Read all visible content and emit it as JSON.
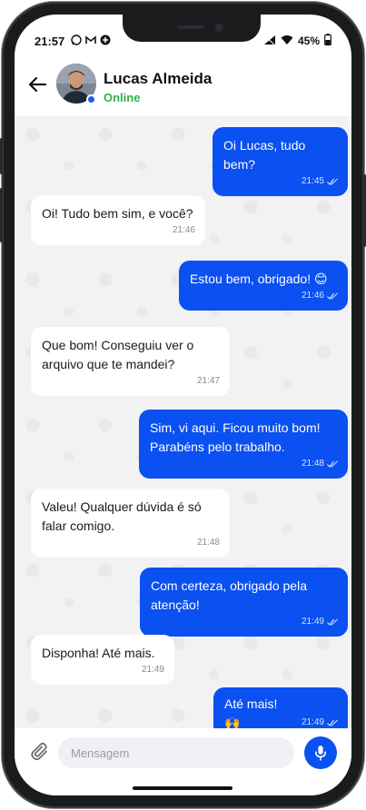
{
  "status_bar": {
    "time": "21:57",
    "battery": "45%"
  },
  "header": {
    "contact_name": "Lucas Almeida",
    "contact_status": "Online"
  },
  "messages": [
    {
      "direction": "out",
      "text": "Oi Lucas, tudo bem?",
      "time": "21:45",
      "read": true
    },
    {
      "direction": "in",
      "text": "Oi! Tudo bem sim, e você?",
      "time": "21:46"
    },
    {
      "direction": "out",
      "text": "Estou bem, obrigado! 😊",
      "time": "21:46",
      "read": true
    },
    {
      "direction": "in",
      "text": "Que bom! Conseguiu ver o\narquivo que te mandei?",
      "time": "21:47"
    },
    {
      "direction": "out",
      "text": "Sim, vi aqui. Ficou muito bom!\nParabéns pelo trabalho.",
      "time": "21:48",
      "read": true
    },
    {
      "direction": "in",
      "text": "Valeu! Qualquer dúvida é só\nfalar comigo.",
      "time": "21:48"
    },
    {
      "direction": "out",
      "text": "Com certeza, obrigado pela\natenção!",
      "time": "21:49",
      "read": true
    },
    {
      "direction": "in",
      "text": "Disponha! Até mais.",
      "time": "21:49"
    },
    {
      "direction": "out",
      "text": "Até mais! 🙌",
      "time": "21:49",
      "read": true
    }
  ],
  "composer": {
    "placeholder": "Mensagem"
  },
  "icons": {
    "back": "arrow-left-icon",
    "attach": "paperclip-icon",
    "mic": "microphone-icon",
    "read_receipt": "double-check-icon"
  },
  "colors": {
    "outgoing_bubble": "#0b50f0",
    "incoming_bubble": "#ffffff",
    "online": "#2fb344",
    "chat_background": "#f2f2f4"
  }
}
